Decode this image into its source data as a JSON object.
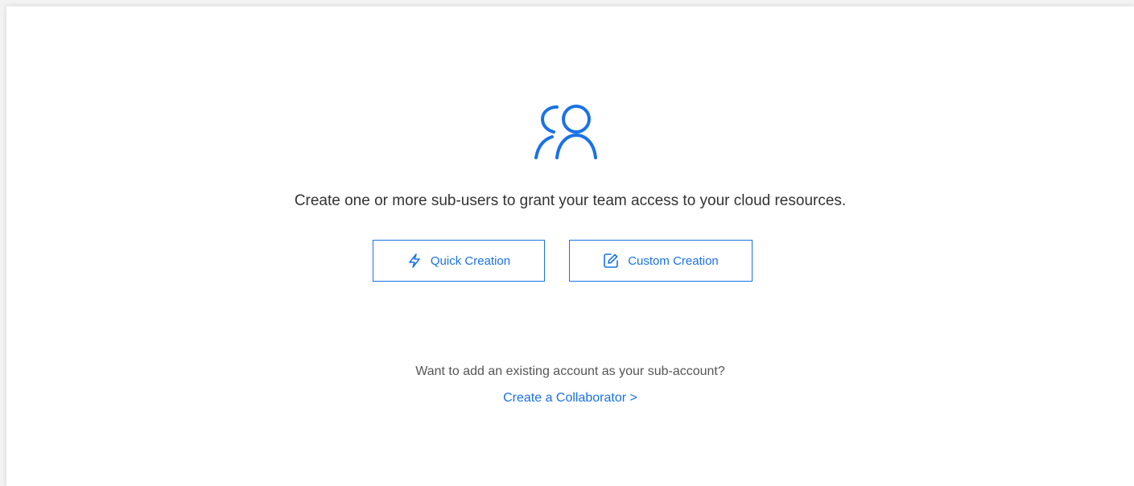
{
  "empty_state": {
    "icon": "users-icon",
    "description": "Create one or more sub-users to grant your team access to your cloud resources.",
    "quick_creation_label": "Quick Creation",
    "quick_creation_icon": "lightning-icon",
    "custom_creation_label": "Custom Creation",
    "custom_creation_icon": "edit-icon",
    "hint": "Want to add an existing account as your sub-account?",
    "collaborator_link": "Create a Collaborator >"
  },
  "colors": {
    "accent": "#1a72e6",
    "text": "#333333",
    "background": "#ffffff"
  }
}
